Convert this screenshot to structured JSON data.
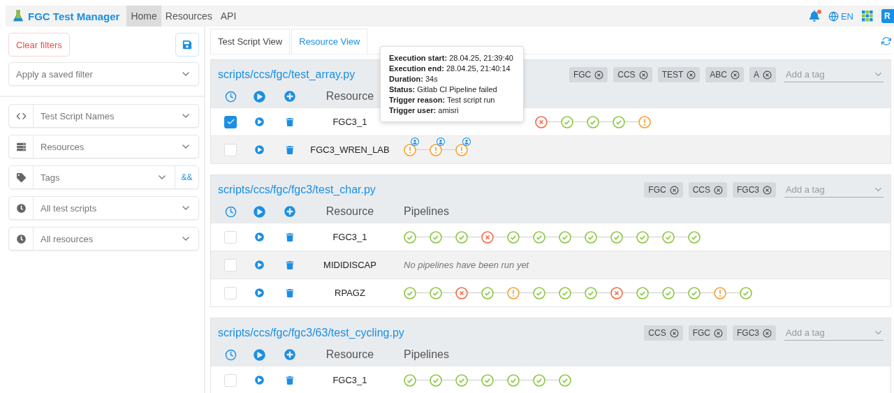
{
  "nav": {
    "brand": "FGC Test Manager",
    "items": [
      {
        "label": "Home",
        "selected": true
      },
      {
        "label": "Resources",
        "selected": false
      },
      {
        "label": "API",
        "selected": false
      }
    ],
    "language": "EN",
    "notification": true,
    "avatar": "R"
  },
  "sidebar": {
    "clear_button": "Clear filters",
    "saved_filter": {
      "placeholder": "Apply a saved filter"
    },
    "filters": [
      {
        "kind": "code",
        "label": "Test Script Names"
      },
      {
        "kind": "server",
        "label": "Resources"
      },
      {
        "kind": "tags",
        "label": "Tags",
        "toggle": "&&"
      },
      {
        "kind": "clock",
        "label": "All test scripts"
      },
      {
        "kind": "clock",
        "label": "All resources"
      }
    ]
  },
  "tabs": [
    {
      "label": "Test Script View",
      "selected": true
    },
    {
      "label": "Resource View",
      "selected": false
    }
  ],
  "tooltip": {
    "lines": [
      {
        "key": "Execution start:",
        "value": "28.04.25, 21:39:40"
      },
      {
        "key": "Execution end:",
        "value": "28.04.25, 21:40:14"
      },
      {
        "key": "Duration:",
        "value": "34s"
      },
      {
        "key": "Status:",
        "value": "Gitlab CI Pipeline failed"
      },
      {
        "key": "Trigger reason:",
        "value": "Test script run"
      },
      {
        "key": "Trigger user:",
        "value": "amisri"
      }
    ]
  },
  "cards": [
    {
      "path": "scripts/ccs/fgc/test_array.py",
      "tags": [
        "FGC",
        "CCS",
        "TEST",
        "ABC",
        "A"
      ],
      "tag_placeholder": "Add a tag",
      "columns": [
        "Resource"
      ],
      "rows": [
        {
          "resource": "FGC3_1",
          "checked": true,
          "covered": true,
          "pipelines": [
            {
              "kind": "fail",
              "user": false
            },
            {
              "kind": "ok",
              "user": false
            },
            {
              "kind": "ok",
              "user": false
            },
            {
              "kind": "ok",
              "user": false
            },
            {
              "kind": "warn",
              "user": false
            }
          ]
        },
        {
          "resource": "FGC3_WREN_LAB",
          "checked": false,
          "covered": false,
          "pipelines": [
            {
              "kind": "warn",
              "user": true
            },
            {
              "kind": "warn",
              "user": true
            },
            {
              "kind": "warn",
              "user": true
            }
          ]
        }
      ]
    },
    {
      "path": "scripts/ccs/fgc/fgc3/test_char.py",
      "tags": [
        "FGC",
        "CCS",
        "FGC3"
      ],
      "tag_placeholder": "Add a tag",
      "columns": [
        "Resource",
        "Pipelines"
      ],
      "rows": [
        {
          "resource": "FGC3_1",
          "checked": false,
          "covered": false,
          "pipelines": [
            {
              "kind": "ok",
              "user": false
            },
            {
              "kind": "ok",
              "user": false
            },
            {
              "kind": "ok",
              "user": false
            },
            {
              "kind": "fail",
              "user": false
            },
            {
              "kind": "ok",
              "user": false
            },
            {
              "kind": "ok",
              "user": false
            },
            {
              "kind": "ok",
              "user": false
            },
            {
              "kind": "ok",
              "user": false
            },
            {
              "kind": "ok",
              "user": false
            },
            {
              "kind": "ok",
              "user": false
            },
            {
              "kind": "ok",
              "user": false
            },
            {
              "kind": "ok",
              "user": false
            }
          ]
        },
        {
          "resource": "MIDIDISCAP",
          "checked": false,
          "empty_text": "No pipelines have been run yet"
        },
        {
          "resource": "RPAGZ",
          "checked": false,
          "covered": false,
          "pipelines": [
            {
              "kind": "ok",
              "user": false
            },
            {
              "kind": "ok",
              "user": false
            },
            {
              "kind": "fail",
              "user": false
            },
            {
              "kind": "ok",
              "user": false
            },
            {
              "kind": "warn",
              "user": false
            },
            {
              "kind": "ok",
              "user": false
            },
            {
              "kind": "ok",
              "user": false
            },
            {
              "kind": "ok",
              "user": false
            },
            {
              "kind": "fail",
              "user": false
            },
            {
              "kind": "ok",
              "user": false
            },
            {
              "kind": "ok",
              "user": false
            },
            {
              "kind": "ok",
              "user": false
            },
            {
              "kind": "warn",
              "user": false
            },
            {
              "kind": "ok",
              "user": false
            }
          ]
        }
      ]
    },
    {
      "path": "scripts/ccs/fgc/fgc3/63/test_cycling.py",
      "tags": [
        "CCS",
        "FGC",
        "FGC3"
      ],
      "tag_placeholder": "Add a tag",
      "columns": [
        "Resource",
        "Pipelines"
      ],
      "rows": [
        {
          "resource": "FGC3_1",
          "checked": false,
          "covered": false,
          "pipelines": [
            {
              "kind": "ok",
              "user": false
            },
            {
              "kind": "ok",
              "user": false
            },
            {
              "kind": "ok",
              "user": false
            },
            {
              "kind": "ok",
              "user": false
            },
            {
              "kind": "ok",
              "user": false
            },
            {
              "kind": "ok",
              "user": false
            },
            {
              "kind": "ok",
              "user": false
            }
          ]
        }
      ]
    }
  ]
}
